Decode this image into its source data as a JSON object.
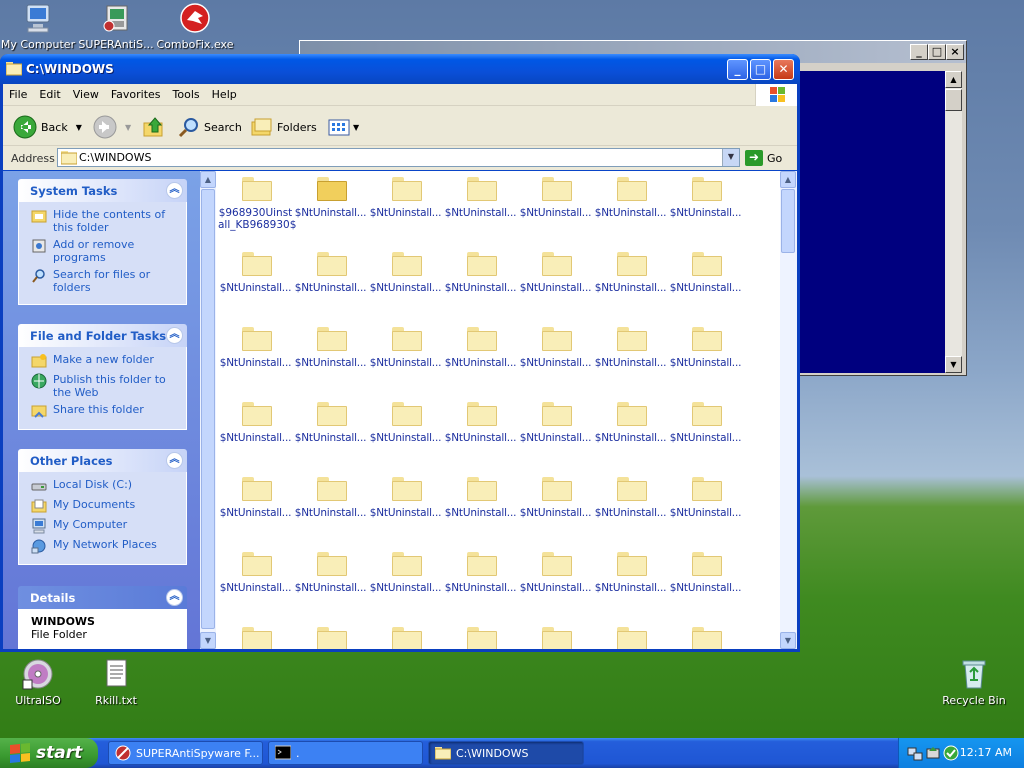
{
  "desktop": {
    "top_icons": [
      {
        "label": "My Computer",
        "icon": "my-computer-icon"
      },
      {
        "label": "SUPERAntiS...",
        "icon": "superantispyware-installer-icon"
      },
      {
        "label": "ComboFix.exe",
        "icon": "combofix-icon"
      }
    ],
    "bottom_icons": [
      {
        "label": "UltraISO",
        "icon": "ultraiso-icon"
      },
      {
        "label": "Rkill.txt",
        "icon": "text-file-icon"
      },
      {
        "label": "Recycle Bin",
        "icon": "recycle-bin-icon"
      }
    ]
  },
  "cmd_window": {
    "min_label": "_",
    "max_label": "□",
    "close_label": "×",
    "background_color": "#00007f"
  },
  "explorer": {
    "title": "C:\\WINDOWS",
    "min_label": "_",
    "max_label": "□",
    "close_label": "✕",
    "menu": [
      "File",
      "Edit",
      "View",
      "Favorites",
      "Tools",
      "Help"
    ],
    "toolbar": {
      "back": "Back",
      "search": "Search",
      "folders": "Folders"
    },
    "address": {
      "label": "Address",
      "value": "C:\\WINDOWS",
      "go": "Go"
    },
    "panels": {
      "system_tasks": {
        "title": "System Tasks",
        "items": [
          "Hide the contents of this folder",
          "Add or remove programs",
          "Search for files or folders"
        ]
      },
      "file_folder_tasks": {
        "title": "File and Folder Tasks",
        "items": [
          "Make a new folder",
          "Publish this folder to the Web",
          "Share this folder"
        ]
      },
      "other_places": {
        "title": "Other Places",
        "items": [
          "Local Disk (C:)",
          "My Documents",
          "My Computer",
          "My Network Places"
        ]
      },
      "details": {
        "title": "Details",
        "name": "WINDOWS",
        "type": "File Folder"
      }
    },
    "files": {
      "first_name_line1": "$968930Uinst",
      "first_name_line2": "all_KB968930$",
      "repeated_name": "$NtUninstall..."
    }
  },
  "taskbar": {
    "start": "start",
    "tasks": [
      {
        "label": "SUPERAntiSpyware F...",
        "icon": "superantispyware-icon"
      },
      {
        "label": ".",
        "icon": "command-prompt-icon"
      },
      {
        "label": "C:\\WINDOWS",
        "icon": "folder-icon"
      }
    ],
    "clock": "12:17 AM"
  }
}
